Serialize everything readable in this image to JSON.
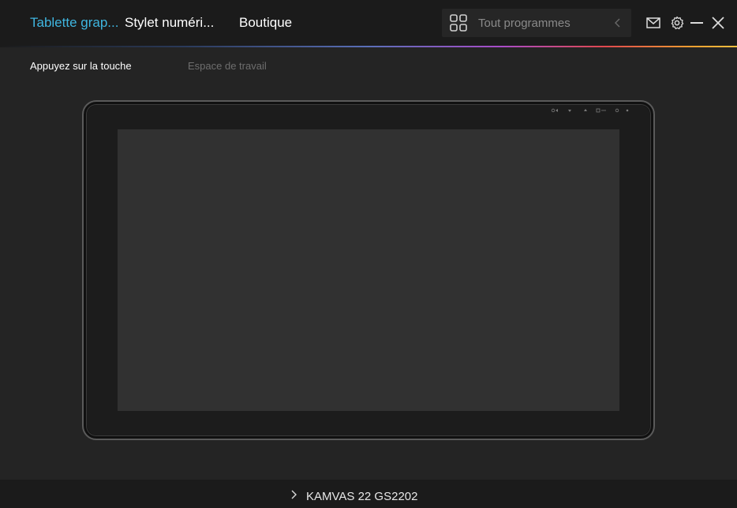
{
  "header": {
    "tabs": [
      {
        "label": "Tablette grap...",
        "active": true
      },
      {
        "label": "Stylet numéri...",
        "active": false
      },
      {
        "label": "Boutique",
        "active": false
      }
    ],
    "search": {
      "placeholder": "Tout programmes"
    },
    "icons": [
      "grid-icon",
      "chevron-left-icon",
      "mail-icon",
      "gear-icon",
      "minimize-icon",
      "close-icon"
    ]
  },
  "subtabs": [
    {
      "label": "Appuyez sur la touche",
      "active": true
    },
    {
      "label": "Espace de travail",
      "active": false
    }
  ],
  "footer": {
    "device_name": "KAMVAS 22 GS2202"
  },
  "colors": {
    "accent": "#3fb6e0",
    "background": "#242424",
    "topbar": "#1b1b1b",
    "screen": "#313131"
  }
}
